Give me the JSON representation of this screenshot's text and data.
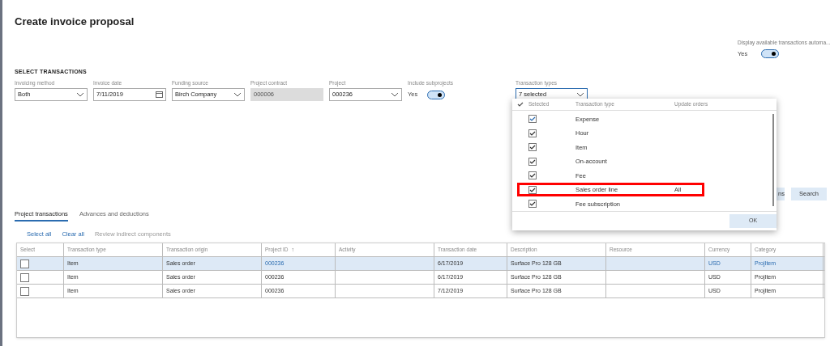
{
  "title": "Create invoice proposal",
  "display_auto": {
    "label": "Display available transactions automa...",
    "value": "Yes",
    "on": true
  },
  "section": "SELECT TRANSACTIONS",
  "fields": [
    {
      "kind": "select",
      "label": "Invoicing method",
      "value": "Both"
    },
    {
      "kind": "date",
      "label": "Invoice date",
      "value": "7/11/2019"
    },
    {
      "kind": "select",
      "label": "Funding source",
      "value": "Birch Company"
    },
    {
      "kind": "readonly",
      "label": "Project contract",
      "value": "000006"
    },
    {
      "kind": "select",
      "label": "Project",
      "value": "000236"
    },
    {
      "kind": "toggle",
      "label": "Include subprojects",
      "value": "Yes",
      "on": true
    }
  ],
  "transaction_types": {
    "label": "Transaction types",
    "value": "7 selected",
    "dropdown": {
      "columns": [
        "Selected",
        "Transaction type",
        "Update orders"
      ],
      "rows": [
        {
          "checked": true,
          "type": "Expense",
          "highlighted": false
        },
        {
          "checked": true,
          "type": "Hour",
          "highlighted": false
        },
        {
          "checked": true,
          "type": "Item",
          "highlighted": false
        },
        {
          "checked": true,
          "type": "On-account",
          "highlighted": false
        },
        {
          "checked": true,
          "type": "Fee",
          "highlighted": false
        },
        {
          "checked": true,
          "type": "Sales order line",
          "update_orders": "All",
          "highlighted": true
        },
        {
          "checked": true,
          "type": "Fee subscription",
          "highlighted": false
        }
      ],
      "ok": "OK"
    }
  },
  "buttons": [
    "ns",
    "Search"
  ],
  "tabs": [
    {
      "label": "Project transactions",
      "selected": true
    },
    {
      "label": "Advances and deductions",
      "selected": false
    }
  ],
  "actions": [
    {
      "label": "Select all",
      "disabled": false
    },
    {
      "label": "Clear all",
      "disabled": false
    },
    {
      "label": "Review indirect components",
      "disabled": true
    }
  ],
  "table": {
    "columns": [
      {
        "label": "Select"
      },
      {
        "label": "Transaction type"
      },
      {
        "label": "Transaction origin"
      },
      {
        "label": "Project ID",
        "sort": "↑"
      },
      {
        "label": "Activity"
      },
      {
        "label": "Transaction date"
      },
      {
        "label": "Description"
      },
      {
        "label": "Resource"
      },
      {
        "label": "Currency"
      },
      {
        "label": "Category"
      }
    ],
    "rows": [
      {
        "selected": true,
        "checked": false,
        "cells": [
          "",
          "Item",
          "Sales order",
          "000236",
          "",
          "6/17/2019",
          "Surface Pro 128 GB",
          "",
          "USD",
          "ProjItem"
        ]
      },
      {
        "selected": false,
        "checked": false,
        "cells": [
          "",
          "Item",
          "Sales order",
          "000236",
          "",
          "6/17/2019",
          "Surface Pro 128 GB",
          "",
          "USD",
          "ProjItem"
        ]
      },
      {
        "selected": false,
        "checked": false,
        "cells": [
          "",
          "Item",
          "Sales order",
          "000236",
          "",
          "7/12/2019",
          "Surface Pro 128 GB",
          "",
          "USD",
          "ProjItem"
        ]
      }
    ]
  }
}
